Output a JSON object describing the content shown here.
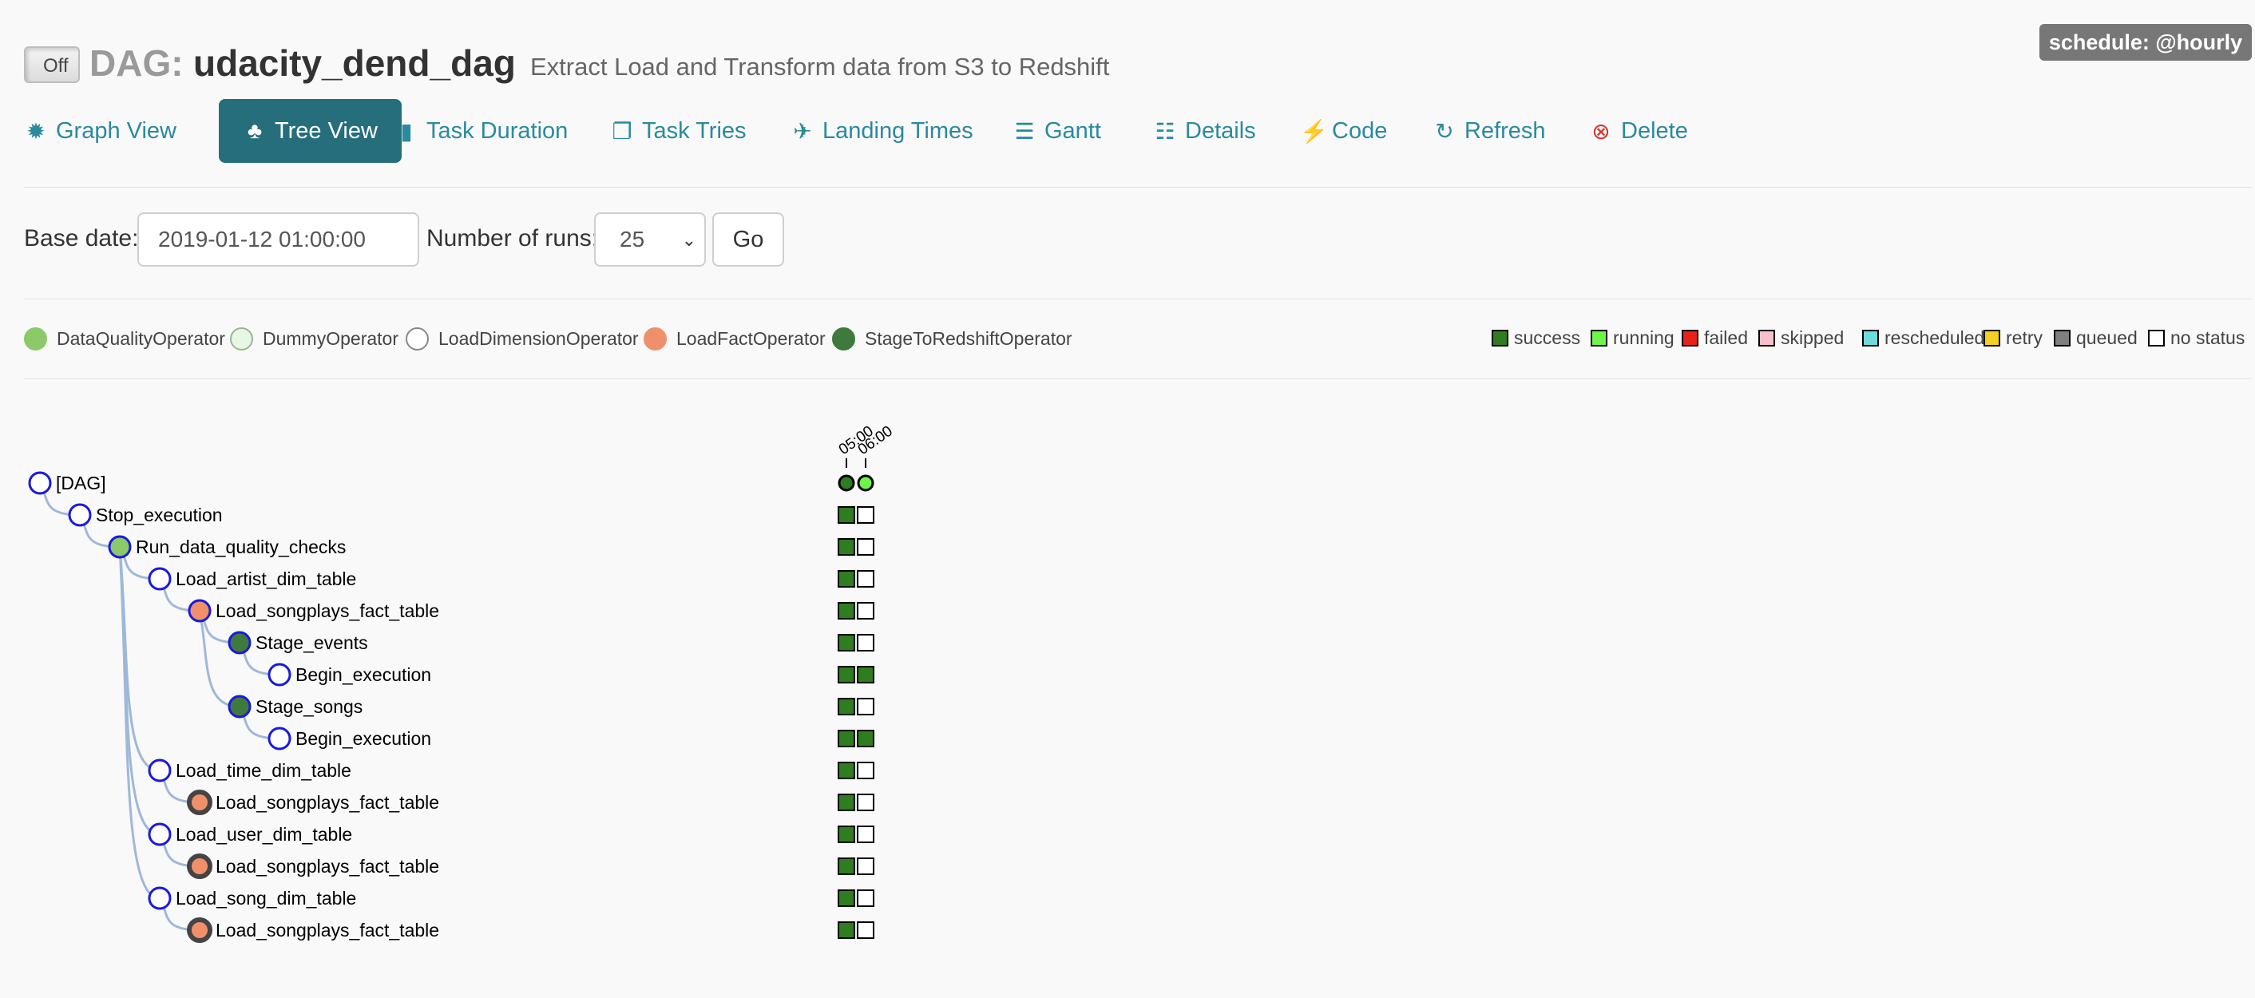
{
  "header": {
    "toggle_label": "Off",
    "dag_prefix": "DAG:",
    "dag_id": "udacity_dend_dag",
    "description": "Extract Load and Transform data from S3 to Redshift",
    "schedule": "schedule: @hourly"
  },
  "nav": [
    {
      "label": "Graph View",
      "icon": "graph-icon",
      "glyph": "✹",
      "active": false
    },
    {
      "label": "Tree View",
      "icon": "tree-icon",
      "glyph": "♣",
      "active": true
    },
    {
      "label": "Task Duration",
      "icon": "bar-chart-icon",
      "glyph": "▮",
      "active": false
    },
    {
      "label": "Task Tries",
      "icon": "copy-icon",
      "glyph": "❐",
      "active": false
    },
    {
      "label": "Landing Times",
      "icon": "plane-icon",
      "glyph": "✈",
      "active": false
    },
    {
      "label": "Gantt",
      "icon": "align-left-icon",
      "glyph": "☰",
      "active": false
    },
    {
      "label": "Details",
      "icon": "list-icon",
      "glyph": "☷",
      "active": false
    },
    {
      "label": "Code",
      "icon": "flash-icon",
      "glyph": "⚡",
      "active": false
    },
    {
      "label": "Refresh",
      "icon": "refresh-icon",
      "glyph": "↻",
      "active": false
    },
    {
      "label": "Delete",
      "icon": "remove-circle-icon",
      "glyph": "⊗",
      "active": false
    }
  ],
  "form": {
    "base_date_label": "Base date:",
    "base_date_value": "2019-01-12 01:00:00",
    "runs_label": "Number of runs:",
    "runs_value": "25",
    "go_label": "Go"
  },
  "operators": [
    {
      "name": "DataQualityOperator",
      "color": "#8cc968"
    },
    {
      "name": "DummyOperator",
      "color": "#e8f7e4"
    },
    {
      "name": "LoadDimensionOperator",
      "color": "#ffffff"
    },
    {
      "name": "LoadFactOperator",
      "color": "#f0906b"
    },
    {
      "name": "StageToRedshiftOperator",
      "color": "#3f7a3d"
    }
  ],
  "states": [
    {
      "name": "success",
      "color": "#2e7d1f"
    },
    {
      "name": "running",
      "color": "#6ef54a"
    },
    {
      "name": "failed",
      "color": "#e8221a"
    },
    {
      "name": "skipped",
      "color": "#f7c0cb"
    },
    {
      "name": "rescheduled",
      "color": "#6fdcdc"
    },
    {
      "name": "retry",
      "color": "#f5d024"
    },
    {
      "name": "queued",
      "color": "#808080"
    },
    {
      "name": "no status",
      "color": "#ffffff"
    }
  ],
  "run_dates": [
    "05:00",
    "06:00"
  ],
  "run_states": [
    "success",
    "running"
  ],
  "tasks": [
    {
      "label": "[DAG]",
      "depth": 0,
      "op": 2,
      "ring": "blue",
      "states": [
        "success",
        "running"
      ],
      "dag": true
    },
    {
      "label": "Stop_execution",
      "depth": 1,
      "op": 1,
      "ring": "blue",
      "states": [
        "success",
        "none"
      ]
    },
    {
      "label": "Run_data_quality_checks",
      "depth": 2,
      "op": 0,
      "ring": "blue",
      "states": [
        "success",
        "none"
      ]
    },
    {
      "label": "Load_artist_dim_table",
      "depth": 3,
      "op": 2,
      "ring": "blue",
      "states": [
        "success",
        "none"
      ]
    },
    {
      "label": "Load_songplays_fact_table",
      "depth": 4,
      "op": 3,
      "ring": "blue",
      "states": [
        "success",
        "none"
      ]
    },
    {
      "label": "Stage_events",
      "depth": 5,
      "op": 4,
      "ring": "blue",
      "states": [
        "success",
        "none"
      ]
    },
    {
      "label": "Begin_execution",
      "depth": 6,
      "op": 1,
      "ring": "blue",
      "states": [
        "success",
        "success"
      ]
    },
    {
      "label": "Stage_songs",
      "depth": 5,
      "op": 4,
      "ring": "blue",
      "states": [
        "success",
        "none"
      ]
    },
    {
      "label": "Begin_execution",
      "depth": 6,
      "op": 1,
      "ring": "blue",
      "states": [
        "success",
        "success"
      ]
    },
    {
      "label": "Load_time_dim_table",
      "depth": 3,
      "op": 2,
      "ring": "blue",
      "states": [
        "success",
        "none"
      ]
    },
    {
      "label": "Load_songplays_fact_table",
      "depth": 4,
      "op": 3,
      "ring": "dark",
      "states": [
        "success",
        "none"
      ]
    },
    {
      "label": "Load_user_dim_table",
      "depth": 3,
      "op": 2,
      "ring": "blue",
      "states": [
        "success",
        "none"
      ]
    },
    {
      "label": "Load_songplays_fact_table",
      "depth": 4,
      "op": 3,
      "ring": "dark",
      "states": [
        "success",
        "none"
      ]
    },
    {
      "label": "Load_song_dim_table",
      "depth": 3,
      "op": 2,
      "ring": "blue",
      "states": [
        "success",
        "none"
      ]
    },
    {
      "label": "Load_songplays_fact_table",
      "depth": 4,
      "op": 3,
      "ring": "dark",
      "states": [
        "success",
        "none"
      ]
    }
  ],
  "links": [
    [
      0,
      1
    ],
    [
      1,
      2
    ],
    [
      2,
      3
    ],
    [
      3,
      4
    ],
    [
      4,
      5
    ],
    [
      5,
      6
    ],
    [
      4,
      7
    ],
    [
      7,
      8
    ],
    [
      2,
      9
    ],
    [
      9,
      10
    ],
    [
      2,
      11
    ],
    [
      11,
      12
    ],
    [
      2,
      13
    ],
    [
      13,
      14
    ]
  ]
}
